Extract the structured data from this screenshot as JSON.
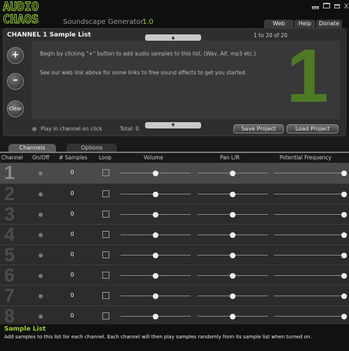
{
  "app": {
    "logo_line1": "AUDIO",
    "logo_line2": "CHAOS",
    "name": "Soundscape Generator",
    "version": "1.0",
    "accent_color": "#9ad13a"
  },
  "window_controls": [
    "minimize-icon",
    "restore-icon",
    "maximize-icon",
    "close-icon"
  ],
  "close_glyph": "X",
  "menu": {
    "web": "Web",
    "help": "Help",
    "donate": "Donate"
  },
  "sample_list": {
    "title": "CHANNEL 1 Sample List",
    "range": "1 to 20 of 20",
    "channel_number": "1",
    "help_line1": "Begin by clicking \"+\" button to add audio samples to this list. (Wav, Aif, mp3 etc.)",
    "help_line2": "See our web link above for some links to free sound effects to get you started.",
    "plus_label": "+",
    "minus_label": "–",
    "clear_label": "Clear",
    "play_label": "Play in channel on click",
    "total": "Total: 0",
    "save_label": "Save Project",
    "load_label": "Load Project",
    "scroll_up": "▲",
    "scroll_down": "▼"
  },
  "tabs": {
    "channels": "Channels",
    "options": "Options"
  },
  "columns": {
    "channel": "Channel",
    "onoff": "On/Off",
    "samples": "# Samples",
    "loop": "Loop",
    "volume": "Volume",
    "pan": "Pan L/R",
    "freq": "Potential Frequency"
  },
  "channels": [
    {
      "num": "1",
      "samples": "0",
      "volume": 0.5,
      "pan": 0.5,
      "freq": 1.0
    },
    {
      "num": "2",
      "samples": "0",
      "volume": 0.5,
      "pan": 0.5,
      "freq": 1.0
    },
    {
      "num": "3",
      "samples": "0",
      "volume": 0.5,
      "pan": 0.5,
      "freq": 1.0
    },
    {
      "num": "4",
      "samples": "0",
      "volume": 0.5,
      "pan": 0.5,
      "freq": 1.0
    },
    {
      "num": "5",
      "samples": "0",
      "volume": 0.5,
      "pan": 0.5,
      "freq": 1.0
    },
    {
      "num": "6",
      "samples": "0",
      "volume": 0.5,
      "pan": 0.5,
      "freq": 1.0
    },
    {
      "num": "7",
      "samples": "0",
      "volume": 0.5,
      "pan": 0.5,
      "freq": 1.0
    },
    {
      "num": "8",
      "samples": "0",
      "volume": 0.5,
      "pan": 0.5,
      "freq": 1.0
    }
  ],
  "footer": {
    "title": "Sample List",
    "text": "Add samples to this list for each channel. Each channel will then play samples randomly from its sample list when turned on."
  }
}
